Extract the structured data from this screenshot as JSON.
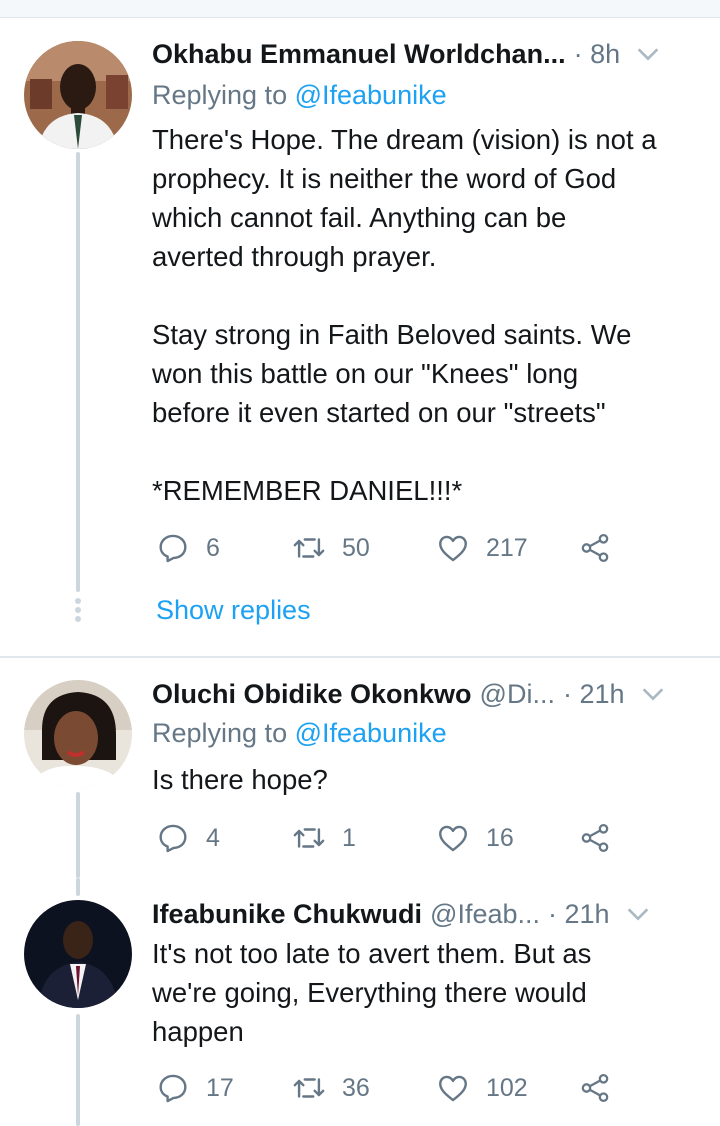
{
  "tweets": [
    {
      "name": "Okhabu Emmanuel Worldchan...",
      "handle": "",
      "time": "· 8h",
      "replying_prefix": "Replying to ",
      "replying_handle": "@Ifeabunike",
      "text": "There's Hope. The dream (vision) is not a\nprophecy. It is neither the word of God\nwhich cannot fail. Anything can be\naverted through prayer.\n\nStay strong in Faith Beloved saints. We\nwon this battle on our \"Knees\" long\nbefore it even started on our \"streets\"\n\n*REMEMBER DANIEL!!!*",
      "replies": "6",
      "retweets": "50",
      "likes": "217",
      "show_replies": "Show replies"
    },
    {
      "name": "Oluchi Obidike Okonkwo",
      "handle": "@Di...",
      "time": "· 21h",
      "replying_prefix": "Replying to ",
      "replying_handle": "@Ifeabunike",
      "text": "Is there hope?",
      "replies": "4",
      "retweets": "1",
      "likes": "16"
    },
    {
      "name": "Ifeabunike Chukwudi",
      "handle": "@Ifeab...",
      "time": "· 21h",
      "text": "It's not too late to avert them. But as\nwe're going, Everything there would\nhappen",
      "replies": "17",
      "retweets": "36",
      "likes": "102"
    }
  ],
  "colors": {
    "accent": "#1da1f2",
    "secondary_text": "#657786",
    "thread_line": "#ccd6dd"
  }
}
